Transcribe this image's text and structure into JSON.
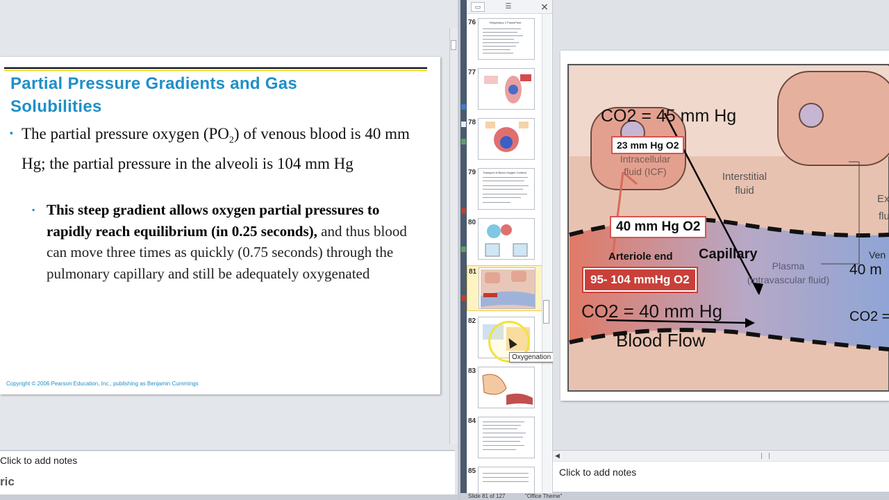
{
  "left_slide": {
    "title": "Partial Pressure Gradients and Gas Solubilities",
    "bullet1_pre": "The partial pressure oxygen (PO",
    "bullet1_sub": "2",
    "bullet1_post": ") of venous blood is 40 mm Hg; the partial pressure in the alveoli is 104 mm Hg",
    "bullet2_bold": "This steep gradient allows oxygen partial pressures to rapidly reach equilibrium (in 0.25 seconds),",
    "bullet2_rest": " and thus blood can move three times as quickly (0.75 seconds) through the pulmonary capillary and still be adequately oxygenated",
    "copyright": "Copyright © 2006 Pearson Education, Inc., publishing as Benjamin Cummings"
  },
  "left_notes": {
    "placeholder": "Click to add notes",
    "fragment": "ric"
  },
  "thumbnails": [
    {
      "number": "76",
      "title": "Respiratory 2 PowerPoint"
    },
    {
      "number": "77"
    },
    {
      "number": "78"
    },
    {
      "number": "79",
      "title": "Transport of Blood Oxygen Content"
    },
    {
      "number": "80"
    },
    {
      "number": "81",
      "selected": true
    },
    {
      "number": "82",
      "title": "Oxygenation of Blood"
    },
    {
      "number": "83"
    },
    {
      "number": "84"
    },
    {
      "number": "85"
    }
  ],
  "tooltip": "Oxygenation of Blood",
  "diagram": {
    "co2_top": "CO2 = 45 mm Hg",
    "o2_icf": "23 mm Hg O2",
    "icf_label": "Intracellular fluid (ICF)",
    "interstitial_label": "Interstitial fluid",
    "ex_label": "Ex",
    "fl_label": "flu",
    "o2_40": "40 mm Hg O2",
    "capillary": "Capillary",
    "arteriole_end": "Arteriole end",
    "plasma_label": "Plasma (intravascular fluid)",
    "o2_arterial": "95- 104 mmHg O2",
    "co2_bottom": "CO2 = 40 mm Hg",
    "blood_flow": "Blood Flow",
    "venule_label": "Ven",
    "venule_o2": "40 m",
    "venule_co2": "CO2 ="
  },
  "right_notes": {
    "placeholder": "Click to add notes"
  },
  "status": {
    "slide_indicator": "Slide 81 of 127",
    "theme": "\"Office Theme\""
  }
}
